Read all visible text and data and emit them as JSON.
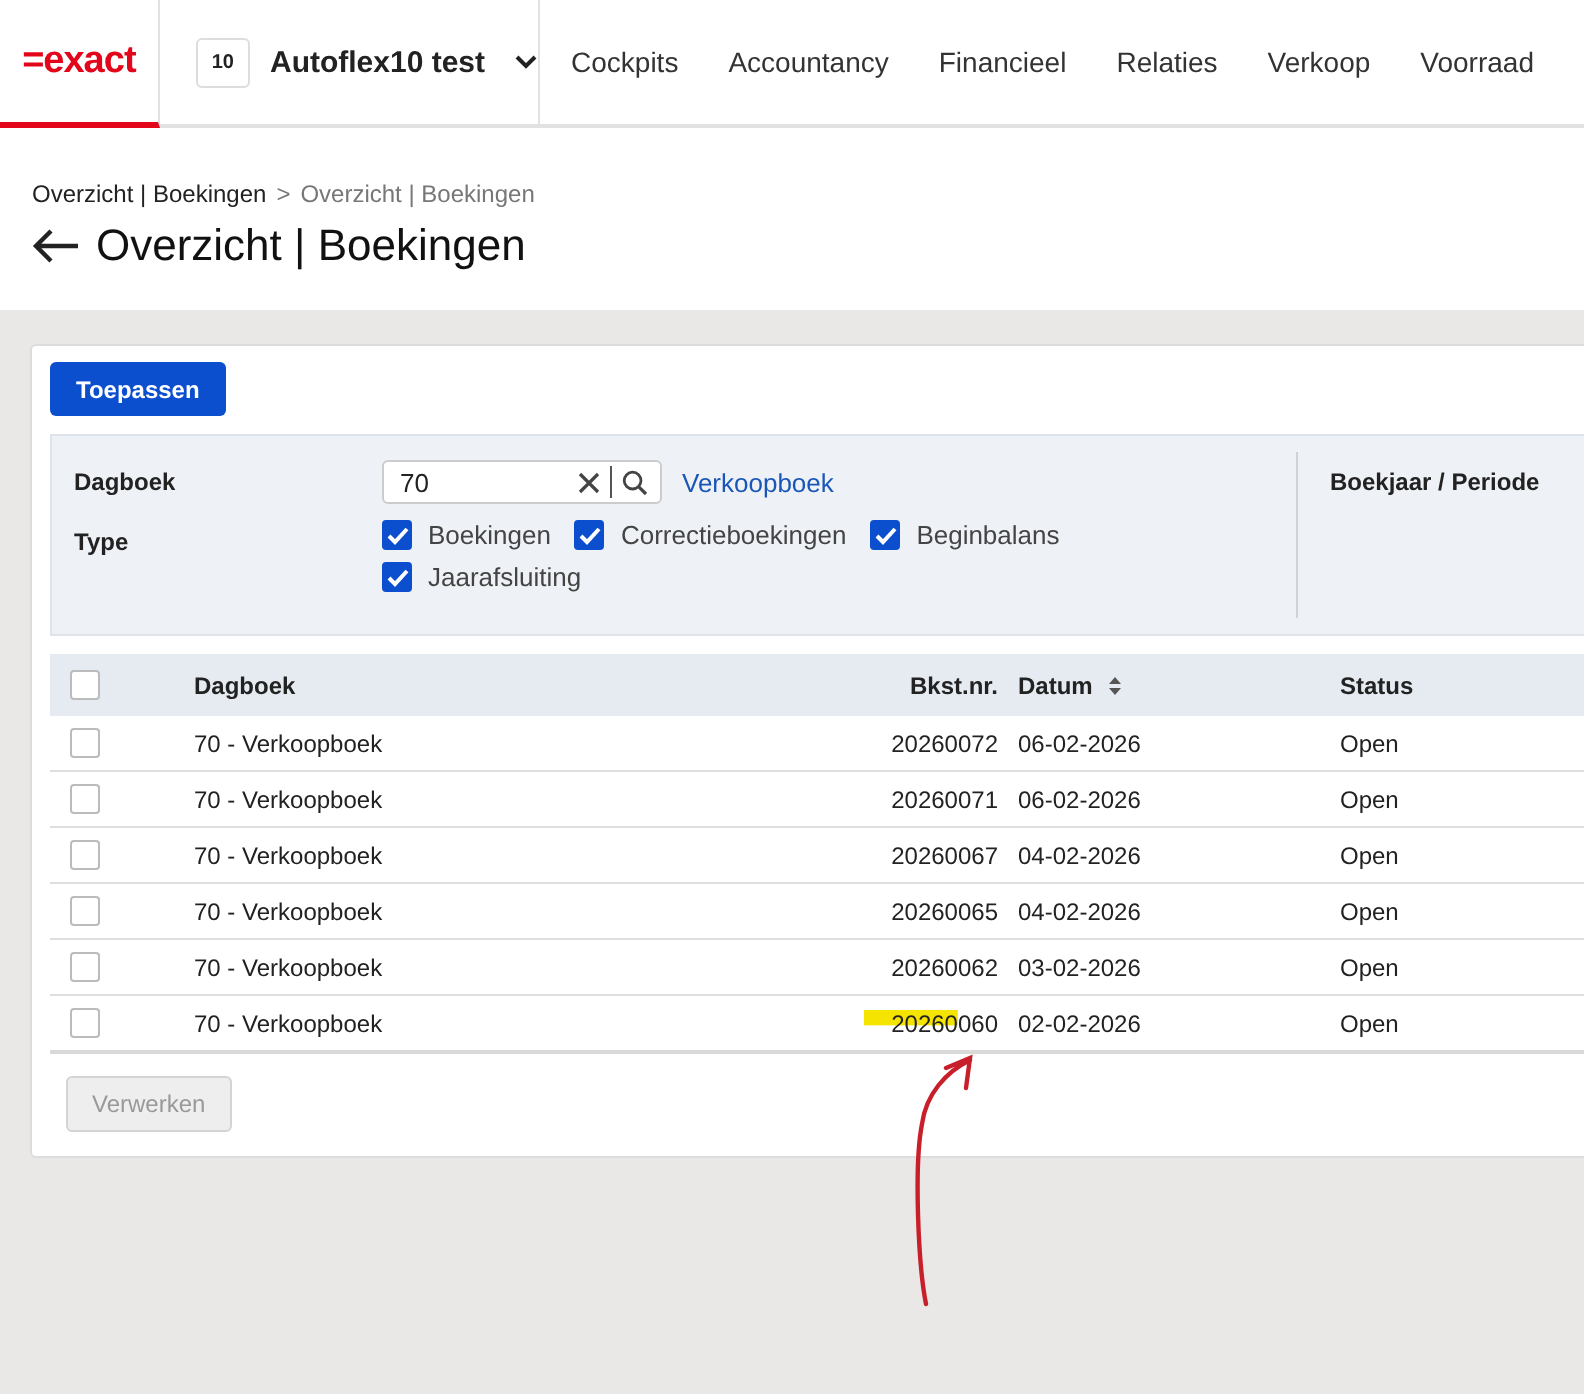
{
  "header": {
    "logo": "=exact",
    "company_code": "10",
    "company_name": "Autoflex10 test",
    "nav": [
      {
        "label": "Cockpits",
        "selected": false
      },
      {
        "label": "Accountancy",
        "selected": false
      },
      {
        "label": "Financieel",
        "selected": false
      },
      {
        "label": "Relaties",
        "selected": false
      },
      {
        "label": "Verkoop",
        "selected": false
      },
      {
        "label": "Voorraad",
        "selected": false
      }
    ]
  },
  "breadcrumb": {
    "parent": "Overzicht | Boekingen",
    "separator": ">",
    "current": "Overzicht | Boekingen"
  },
  "page_title": "Overzicht | Boekingen",
  "apply_button": "Toepassen",
  "filters": {
    "dagboek_label": "Dagboek",
    "dagboek_value": "70",
    "dagboek_link": "Verkoopboek",
    "type_label": "Type",
    "types": [
      {
        "label": "Boekingen",
        "checked": true
      },
      {
        "label": "Correctieboekingen",
        "checked": true
      },
      {
        "label": "Beginbalans",
        "checked": true
      },
      {
        "label": "Jaarafsluiting",
        "checked": true
      }
    ],
    "period_label": "Boekjaar / Periode"
  },
  "table": {
    "columns": [
      "Dagboek",
      "Bkst.nr.",
      "Datum",
      "Status"
    ],
    "header_checked": false,
    "rows": [
      {
        "checked": false,
        "dagboek": "70 - Verkoopboek",
        "number": "20260072",
        "date": "06-02-2026",
        "status": "Open",
        "highlighted": false
      },
      {
        "checked": false,
        "dagboek": "70 - Verkoopboek",
        "number": "20260071",
        "date": "06-02-2026",
        "status": "Open",
        "highlighted": false
      },
      {
        "checked": false,
        "dagboek": "70 - Verkoopboek",
        "number": "20260067",
        "date": "04-02-2026",
        "status": "Open",
        "highlighted": false
      },
      {
        "checked": false,
        "dagboek": "70 - Verkoopboek",
        "number": "20260065",
        "date": "04-02-2026",
        "status": "Open",
        "highlighted": false
      },
      {
        "checked": false,
        "dagboek": "70 - Verkoopboek",
        "number": "20260062",
        "date": "03-02-2026",
        "status": "Open",
        "highlighted": false
      },
      {
        "checked": false,
        "dagboek": "70 - Verkoopboek",
        "number": "20260060",
        "date": "02-02-2026",
        "status": "Open",
        "highlighted": true
      }
    ]
  },
  "process_button": {
    "label": "Verwerken",
    "disabled": true
  }
}
